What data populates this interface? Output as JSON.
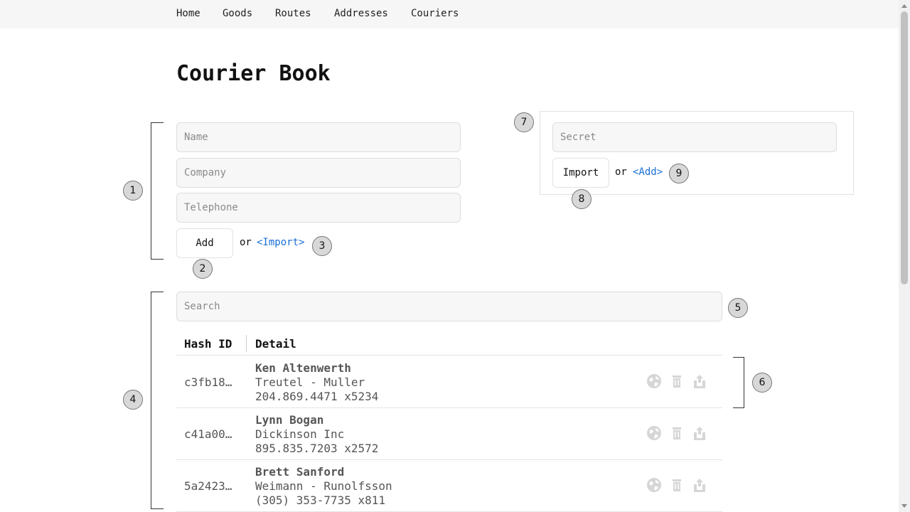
{
  "nav": {
    "items": [
      "Home",
      "Goods",
      "Routes",
      "Addresses",
      "Couriers"
    ]
  },
  "page": {
    "title": "Courier Book"
  },
  "add_form": {
    "name_placeholder": "Name",
    "company_placeholder": "Company",
    "telephone_placeholder": "Telephone",
    "add_label": "Add",
    "or_text": "or",
    "import_link": "<Import>"
  },
  "import_form": {
    "secret_placeholder": "Secret",
    "import_label": "Import",
    "or_text": "or",
    "add_link": "<Add>"
  },
  "search": {
    "placeholder": "Search"
  },
  "table": {
    "headers": [
      "Hash ID",
      "Detail"
    ],
    "rows": [
      {
        "hash": "c3fb18…",
        "name": "Ken Altenwerth",
        "company": "Treutel - Muller",
        "phone": "204.869.4471 x5234"
      },
      {
        "hash": "c41a00…",
        "name": "Lynn Bogan",
        "company": "Dickinson Inc",
        "phone": "895.835.7203 x2572"
      },
      {
        "hash": "5a2423…",
        "name": "Brett Sanford",
        "company": "Weimann - Runolfsson",
        "phone": "(305) 353-7735 x811"
      }
    ],
    "row_actions": [
      "globe-icon",
      "trash-icon",
      "share-icon"
    ]
  },
  "annotations": [
    "1",
    "2",
    "3",
    "4",
    "5",
    "6",
    "7",
    "8",
    "9"
  ],
  "colors": {
    "link": "#1a6ed8",
    "nav_bg": "#f6f6f6",
    "field_bg": "#f7f7f7",
    "icon": "#d6d6d6"
  }
}
